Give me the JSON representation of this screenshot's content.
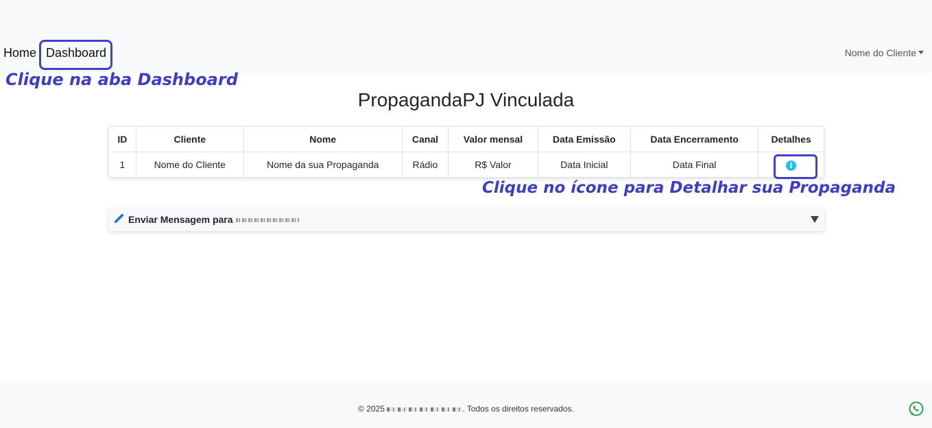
{
  "navbar": {
    "links": [
      {
        "label": "Home"
      },
      {
        "label": "Dashboard"
      }
    ],
    "user_menu_label": "Nome do Cliente"
  },
  "annotations": {
    "dashboard_hint": "Clique na aba Dashboard",
    "icon_hint": "Clique no ícone para Detalhar sua Propaganda",
    "color": "#3d3dc8"
  },
  "page": {
    "title": "PropagandaPJ Vinculada"
  },
  "table": {
    "headers": [
      "ID",
      "Cliente",
      "Nome",
      "Canal",
      "Valor mensal",
      "Data Emissão",
      "Data Encerramento",
      "Detalhes"
    ],
    "rows": [
      {
        "id": "1",
        "cliente": "Nome do Cliente",
        "nome": "Nome da sua Propaganda",
        "canal": "Rádio",
        "valor": "R$ Valor",
        "emissao": "Data Inicial",
        "encerramento": "Data Final",
        "detalhes_icon": "info-icon"
      }
    ]
  },
  "message_panel": {
    "label": "Enviar Mensagem para",
    "icon": "pencil-icon",
    "toggle_icon": "triangle-down-icon"
  },
  "footer": {
    "text_prefix": "© 2025",
    "text_suffix": ". Todos os direitos reservados.",
    "whatsapp_icon": "whatsapp-icon",
    "whatsapp_color": "#25a244"
  },
  "colors": {
    "info_icon": "#1ec0f0",
    "pencil_icon": "#1a73e8",
    "highlight_border": "#4040c8"
  }
}
